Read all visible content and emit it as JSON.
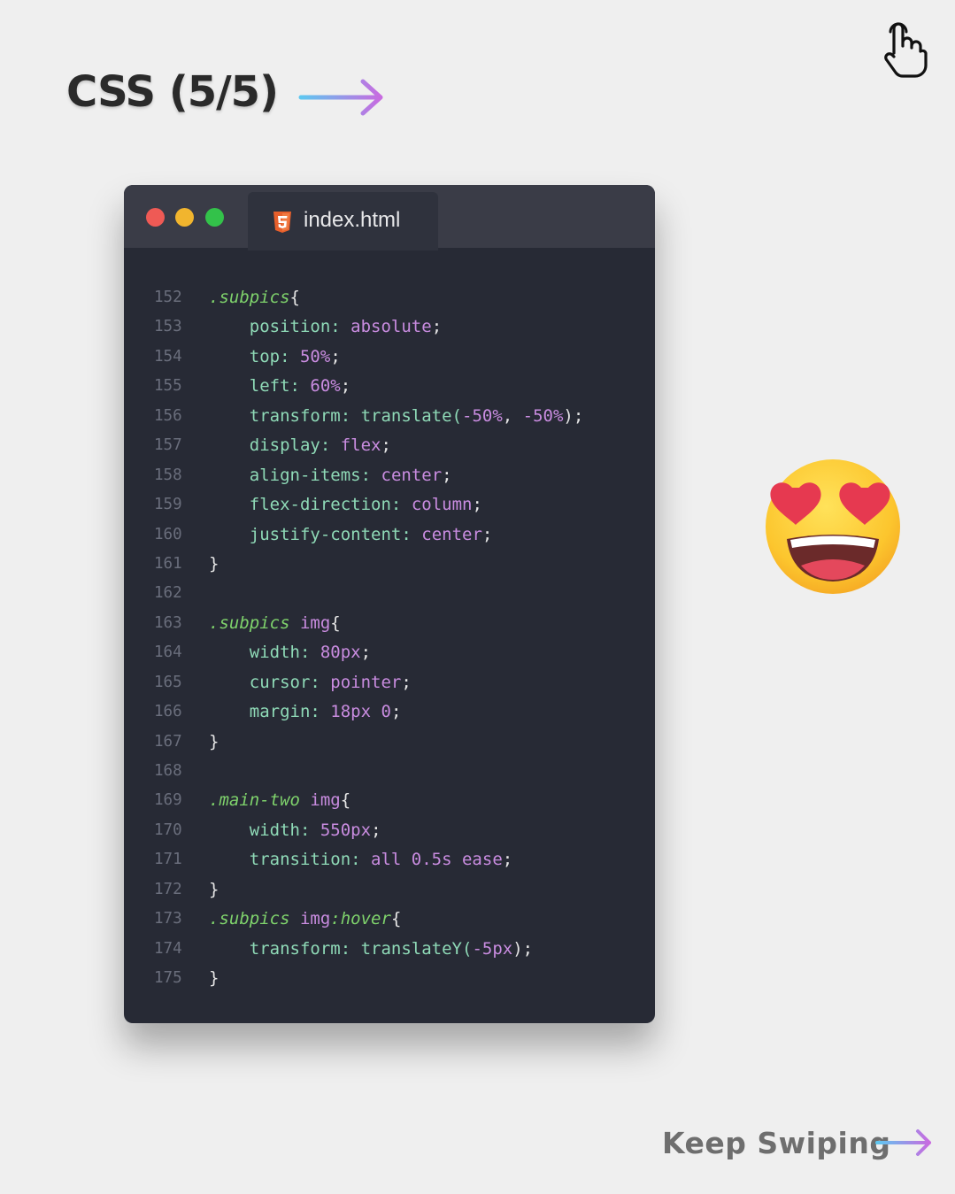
{
  "header": {
    "title": "CSS (5/5)"
  },
  "colors": {
    "background": "#efefef",
    "editor_bg": "#272a35",
    "titlebar_bg": "#3a3c47",
    "selector": "#7fd36c",
    "property": "#8fdab7",
    "value": "#c98ce0",
    "arrow_start": "#5ec7f0",
    "arrow_end": "#c86be0"
  },
  "editor": {
    "tab_label": "index.html",
    "tab_icon": "html5-icon",
    "lines": [
      {
        "n": "152",
        "tokens": [
          [
            "sel",
            ".subpics"
          ],
          [
            "punc",
            "{"
          ]
        ]
      },
      {
        "n": "153",
        "tokens": [
          [
            "sp",
            "    "
          ],
          [
            "prop",
            "position"
          ],
          [
            "prop",
            ": "
          ],
          [
            "val",
            "absolute"
          ],
          [
            "punc",
            ";"
          ]
        ]
      },
      {
        "n": "154",
        "tokens": [
          [
            "sp",
            "    "
          ],
          [
            "prop",
            "top"
          ],
          [
            "prop",
            ": "
          ],
          [
            "num",
            "50%"
          ],
          [
            "punc",
            ";"
          ]
        ]
      },
      {
        "n": "155",
        "tokens": [
          [
            "sp",
            "    "
          ],
          [
            "prop",
            "left"
          ],
          [
            "prop",
            ": "
          ],
          [
            "num",
            "60%"
          ],
          [
            "punc",
            ";"
          ]
        ]
      },
      {
        "n": "156",
        "tokens": [
          [
            "sp",
            "    "
          ],
          [
            "prop",
            "transform"
          ],
          [
            "prop",
            ": "
          ],
          [
            "fn",
            "translate("
          ],
          [
            "num",
            "-50%"
          ],
          [
            "punc",
            ", "
          ],
          [
            "num",
            "-50%"
          ],
          [
            "punc",
            ");"
          ]
        ]
      },
      {
        "n": "157",
        "tokens": [
          [
            "sp",
            "    "
          ],
          [
            "prop",
            "display"
          ],
          [
            "prop",
            ": "
          ],
          [
            "val",
            "flex"
          ],
          [
            "punc",
            ";"
          ]
        ]
      },
      {
        "n": "158",
        "tokens": [
          [
            "sp",
            "    "
          ],
          [
            "prop",
            "align-items"
          ],
          [
            "prop",
            ": "
          ],
          [
            "val",
            "center"
          ],
          [
            "punc",
            ";"
          ]
        ]
      },
      {
        "n": "159",
        "tokens": [
          [
            "sp",
            "    "
          ],
          [
            "prop",
            "flex-direction"
          ],
          [
            "prop",
            ": "
          ],
          [
            "val",
            "column"
          ],
          [
            "punc",
            ";"
          ]
        ]
      },
      {
        "n": "160",
        "tokens": [
          [
            "sp",
            "    "
          ],
          [
            "prop",
            "justify-content"
          ],
          [
            "prop",
            ": "
          ],
          [
            "val",
            "center"
          ],
          [
            "punc",
            ";"
          ]
        ]
      },
      {
        "n": "161",
        "tokens": [
          [
            "punc",
            "}"
          ]
        ]
      },
      {
        "n": "162",
        "tokens": []
      },
      {
        "n": "163",
        "tokens": [
          [
            "sel",
            ".subpics"
          ],
          [
            "punc",
            " "
          ],
          [
            "tag",
            "img"
          ],
          [
            "punc",
            "{"
          ]
        ]
      },
      {
        "n": "164",
        "tokens": [
          [
            "sp",
            "    "
          ],
          [
            "prop",
            "width"
          ],
          [
            "prop",
            ": "
          ],
          [
            "num",
            "80px"
          ],
          [
            "punc",
            ";"
          ]
        ]
      },
      {
        "n": "165",
        "tokens": [
          [
            "sp",
            "    "
          ],
          [
            "prop",
            "cursor"
          ],
          [
            "prop",
            ": "
          ],
          [
            "val",
            "pointer"
          ],
          [
            "punc",
            ";"
          ]
        ]
      },
      {
        "n": "166",
        "tokens": [
          [
            "sp",
            "    "
          ],
          [
            "prop",
            "margin"
          ],
          [
            "prop",
            ": "
          ],
          [
            "num",
            "18px 0"
          ],
          [
            "punc",
            ";"
          ]
        ]
      },
      {
        "n": "167",
        "tokens": [
          [
            "punc",
            "}"
          ]
        ]
      },
      {
        "n": "168",
        "tokens": []
      },
      {
        "n": "169",
        "tokens": [
          [
            "sel",
            ".main-two"
          ],
          [
            "punc",
            " "
          ],
          [
            "tag",
            "img"
          ],
          [
            "punc",
            "{"
          ]
        ]
      },
      {
        "n": "170",
        "tokens": [
          [
            "sp",
            "    "
          ],
          [
            "prop",
            "width"
          ],
          [
            "prop",
            ": "
          ],
          [
            "num",
            "550px"
          ],
          [
            "punc",
            ";"
          ]
        ]
      },
      {
        "n": "171",
        "tokens": [
          [
            "sp",
            "    "
          ],
          [
            "prop",
            "transition"
          ],
          [
            "prop",
            ": "
          ],
          [
            "val",
            "all 0.5s ease"
          ],
          [
            "punc",
            ";"
          ]
        ]
      },
      {
        "n": "172",
        "tokens": [
          [
            "punc",
            "}"
          ]
        ]
      },
      {
        "n": "173",
        "tokens": [
          [
            "sel",
            ".subpics"
          ],
          [
            "punc",
            " "
          ],
          [
            "tag",
            "img"
          ],
          [
            "sel",
            ":hover"
          ],
          [
            "punc",
            "{"
          ]
        ]
      },
      {
        "n": "174",
        "tokens": [
          [
            "sp",
            "    "
          ],
          [
            "prop",
            "transform"
          ],
          [
            "prop",
            ": "
          ],
          [
            "fn",
            "translateY("
          ],
          [
            "num",
            "-5px"
          ],
          [
            "punc",
            ");"
          ]
        ]
      },
      {
        "n": "175",
        "tokens": [
          [
            "punc",
            "}"
          ]
        ]
      }
    ]
  },
  "footer": {
    "keep_swiping": "Keep Swiping"
  },
  "icons": {
    "header_arrow": "arrow-right-icon",
    "hand": "pointing-hand-icon",
    "emoji": "heart-eyes-emoji-icon",
    "footer_arrow": "arrow-right-icon"
  }
}
